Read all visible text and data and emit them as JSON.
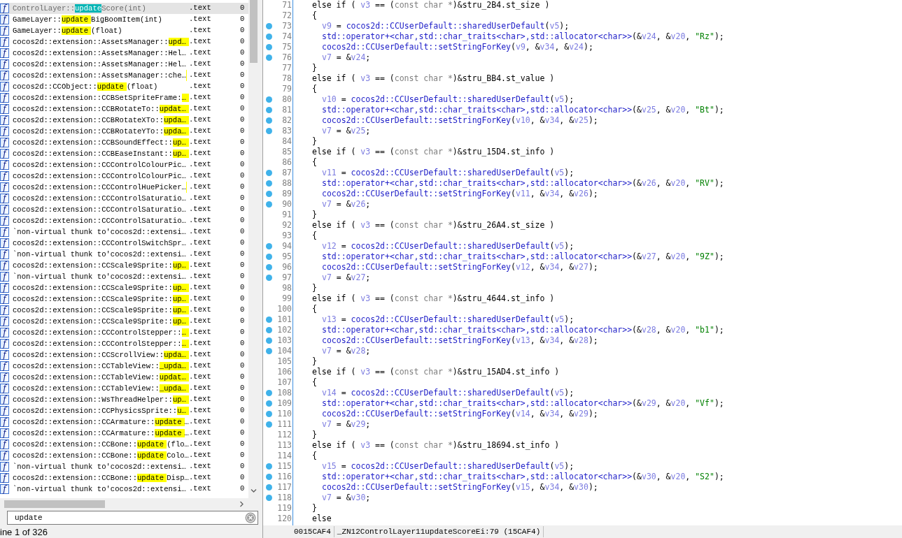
{
  "function_list": {
    "rows": [
      {
        "icon": "f",
        "before": "ControlLayer::",
        "match": "update",
        "after": "Score(int)",
        "segment": ".text",
        "column_3": "0",
        "selected": true
      },
      {
        "icon": "f",
        "before": "GameLayer::",
        "match": "update",
        "after": "BigBoomItem(int)",
        "segment": ".text",
        "column_3": "0",
        "selected": false
      },
      {
        "icon": "f",
        "before": "GameLayer::",
        "match": "update",
        "after": "(float)",
        "segment": ".text",
        "column_3": "0",
        "selected": false
      },
      {
        "icon": "f",
        "before": "cocos2d::extension::AssetsManager::",
        "match": "upd…",
        "segment": ".text",
        "column_3": "0",
        "selected": false
      },
      {
        "icon": "f",
        "before": "cocos2d::extension::AssetsManager::Hel…",
        "segment": ".text",
        "column_3": "0",
        "selected": false
      },
      {
        "icon": "f",
        "before": "cocos2d::extension::AssetsManager::Hel…",
        "segment": ".text",
        "column_3": "0",
        "selected": false
      },
      {
        "icon": "f",
        "before": "cocos2d::extension::AssetsManager::che…",
        "highlight_tail": true,
        "segment": ".text",
        "column_3": "0",
        "selected": false
      },
      {
        "icon": "f",
        "before": "cocos2d::CCObject::",
        "match": "update",
        "after": "(float)",
        "segment": ".text",
        "column_3": "0",
        "selected": false
      },
      {
        "icon": "f",
        "before": "cocos2d::extension::CCBSetSpriteFrame:",
        "match": "…",
        "segment": ".text",
        "column_3": "0",
        "selected": false
      },
      {
        "icon": "f",
        "before": "cocos2d::extension::CCBRotateTo::",
        "match": "updat…",
        "segment": ".text",
        "column_3": "0",
        "selected": false
      },
      {
        "icon": "f",
        "before": "cocos2d::extension::CCBRotateXTo::",
        "match": "upda…",
        "segment": ".text",
        "column_3": "0",
        "selected": false
      },
      {
        "icon": "f",
        "before": "cocos2d::extension::CCBRotateYTo::",
        "match": "upda…",
        "segment": ".text",
        "column_3": "0",
        "selected": false
      },
      {
        "icon": "f",
        "before": "cocos2d::extension::CCBSoundEffect::",
        "match": "up…",
        "segment": ".text",
        "column_3": "0",
        "selected": false
      },
      {
        "icon": "f",
        "before": "cocos2d::extension::CCBEaseInstant::",
        "match": "up…",
        "segment": ".text",
        "column_3": "0",
        "selected": false
      },
      {
        "icon": "f",
        "before": "cocos2d::extension::CCControlColourPic…",
        "segment": ".text",
        "column_3": "0",
        "selected": false
      },
      {
        "icon": "f",
        "before": "cocos2d::extension::CCControlColourPic…",
        "segment": ".text",
        "column_3": "0",
        "selected": false
      },
      {
        "icon": "f",
        "before": "cocos2d::extension::CCControlHuePicker…",
        "highlight_tail": true,
        "segment": ".text",
        "column_3": "0",
        "selected": false
      },
      {
        "icon": "f",
        "before": "cocos2d::extension::CCControlSaturatio…",
        "segment": ".text",
        "column_3": "0",
        "selected": false
      },
      {
        "icon": "f",
        "before": "cocos2d::extension::CCControlSaturatio…",
        "segment": ".text",
        "column_3": "0",
        "selected": false
      },
      {
        "icon": "f",
        "before": "cocos2d::extension::CCControlSaturatio…",
        "segment": ".text",
        "column_3": "0",
        "selected": false
      },
      {
        "icon": "f",
        "before": "`non-virtual thunk to'cocos2d::extensi…",
        "segment": ".text",
        "column_3": "0",
        "selected": false
      },
      {
        "icon": "f",
        "before": "cocos2d::extension::CCControlSwitchSpr…",
        "segment": ".text",
        "column_3": "0",
        "selected": false
      },
      {
        "icon": "f",
        "before": "`non-virtual thunk to'cocos2d::extensi…",
        "segment": ".text",
        "column_3": "0",
        "selected": false
      },
      {
        "icon": "f",
        "before": "cocos2d::extension::CCScale9Sprite::",
        "match": "up…",
        "segment": ".text",
        "column_3": "0",
        "selected": false
      },
      {
        "icon": "f",
        "before": "`non-virtual thunk to'cocos2d::extensi…",
        "segment": ".text",
        "column_3": "0",
        "selected": false
      },
      {
        "icon": "f",
        "before": "cocos2d::extension::CCScale9Sprite::",
        "match": "up…",
        "segment": ".text",
        "column_3": "0",
        "selected": false
      },
      {
        "icon": "f",
        "before": "cocos2d::extension::CCScale9Sprite::",
        "match": "up…",
        "segment": ".text",
        "column_3": "0",
        "selected": false
      },
      {
        "icon": "f",
        "before": "cocos2d::extension::CCScale9Sprite::",
        "match": "up…",
        "segment": ".text",
        "column_3": "0",
        "selected": false
      },
      {
        "icon": "f",
        "before": "cocos2d::extension::CCScale9Sprite::",
        "match": "up…",
        "segment": ".text",
        "column_3": "0",
        "selected": false
      },
      {
        "icon": "f",
        "before": "cocos2d::extension::CCControlStepper::",
        "match": "…",
        "segment": ".text",
        "column_3": "0",
        "selected": false
      },
      {
        "icon": "f",
        "before": "cocos2d::extension::CCControlStepper::",
        "match": "…",
        "segment": ".text",
        "column_3": "0",
        "selected": false
      },
      {
        "icon": "f",
        "before": "cocos2d::extension::CCScrollView::",
        "match": "upda…",
        "segment": ".text",
        "column_3": "0",
        "selected": false
      },
      {
        "icon": "f",
        "before": "cocos2d::extension::CCTableView::",
        "match": "_upda…",
        "segment": ".text",
        "column_3": "0",
        "selected": false
      },
      {
        "icon": "f",
        "before": "cocos2d::extension::CCTableView::",
        "match": "updat…",
        "segment": ".text",
        "column_3": "0",
        "selected": false
      },
      {
        "icon": "f",
        "before": "cocos2d::extension::CCTableView::",
        "match": "_upda…",
        "segment": ".text",
        "column_3": "0",
        "selected": false
      },
      {
        "icon": "f",
        "before": "cocos2d::extension::WsThreadHelper::",
        "match": "up…",
        "segment": ".text",
        "column_3": "0",
        "selected": false
      },
      {
        "icon": "f",
        "before": "cocos2d::extension::CCPhysicsSprite::",
        "match": "u…",
        "segment": ".text",
        "column_3": "0",
        "selected": false
      },
      {
        "icon": "f",
        "before": "cocos2d::extension::CCArmature::",
        "match": "update",
        "after": "…",
        "segment": ".text",
        "column_3": "0",
        "selected": false
      },
      {
        "icon": "f",
        "before": "cocos2d::extension::CCArmature::",
        "match": "update",
        "after": "…",
        "segment": ".text",
        "column_3": "0",
        "selected": false
      },
      {
        "icon": "f",
        "before": "cocos2d::extension::CCBone::",
        "match": "update",
        "after": "(flo…",
        "segment": ".text",
        "column_3": "0",
        "selected": false
      },
      {
        "icon": "f",
        "before": "cocos2d::extension::CCBone::",
        "match": "update",
        "after": "Colo…",
        "segment": ".text",
        "column_3": "0",
        "selected": false
      },
      {
        "icon": "f",
        "before": "`non-virtual thunk to'cocos2d::extensi…",
        "segment": ".text",
        "column_3": "0",
        "selected": false
      },
      {
        "icon": "f",
        "before": "cocos2d::extension::CCBone::",
        "match": "update",
        "after": "Disp…",
        "segment": ".text",
        "column_3": "0",
        "selected": false
      },
      {
        "icon": "f",
        "before": "`non-virtual thunk to'cocos2d::extensi…",
        "segment": ".text",
        "column_3": "0",
        "selected": false
      }
    ],
    "search": {
      "value": "update"
    },
    "status": "ine 1 of 326"
  },
  "code": {
    "lines": [
      {
        "number": "71",
        "dot": false,
        "tokens": [
          {
            "kind": "plain",
            "text": "else if ( "
          },
          {
            "kind": "var",
            "text": "v3"
          },
          {
            "kind": "plain",
            "text": " == ("
          },
          {
            "kind": "type",
            "text": "const char *"
          },
          {
            "kind": "plain",
            "text": ")&stru_2B4.st_size )"
          }
        ]
      },
      {
        "number": "72",
        "dot": false,
        "tokens": [
          {
            "kind": "plain",
            "text": "{"
          }
        ],
        "children": [
          {
            "number": "73",
            "dot": true,
            "tokens": [
              {
                "kind": "var",
                "text": "v9"
              },
              {
                "kind": "plain",
                "text": " = "
              },
              {
                "kind": "func",
                "text": "cocos2d::CCUserDefault::sharedUserDefault"
              },
              {
                "kind": "plain",
                "text": "("
              },
              {
                "kind": "var",
                "text": "v5"
              },
              {
                "kind": "plain",
                "text": ");"
              }
            ]
          },
          {
            "number": "74",
            "dot": true,
            "tokens": [
              {
                "kind": "func",
                "text": "std::operator+<char,std::char_traits<char>,std::allocator<char>>"
              },
              {
                "kind": "plain",
                "text": "(&"
              },
              {
                "kind": "var",
                "text": "v24"
              },
              {
                "kind": "plain",
                "text": ", &"
              },
              {
                "kind": "var",
                "text": "v20"
              },
              {
                "kind": "plain",
                "text": ", "
              },
              {
                "kind": "str",
                "text": "\"Rz\""
              },
              {
                "kind": "plain",
                "text": ");"
              }
            ]
          },
          {
            "number": "75",
            "dot": true,
            "tokens": [
              {
                "kind": "func",
                "text": "cocos2d::CCUserDefault::setStringForKey"
              },
              {
                "kind": "plain",
                "text": "("
              },
              {
                "kind": "var",
                "text": "v9"
              },
              {
                "kind": "plain",
                "text": ", &"
              },
              {
                "kind": "var",
                "text": "v34"
              },
              {
                "kind": "plain",
                "text": ", &"
              },
              {
                "kind": "var",
                "text": "v24"
              },
              {
                "kind": "plain",
                "text": ");"
              }
            ]
          },
          {
            "number": "76",
            "dot": true,
            "tokens": [
              {
                "kind": "var",
                "text": "v7"
              },
              {
                "kind": "plain",
                "text": " = &"
              },
              {
                "kind": "var",
                "text": "v24"
              },
              {
                "kind": "plain",
                "text": ";"
              }
            ]
          }
        ]
      },
      {
        "number": "77",
        "dot": false,
        "tokens": [
          {
            "kind": "plain",
            "text": "}"
          }
        ]
      },
      {
        "number": "78",
        "dot": false,
        "tokens": [
          {
            "kind": "plain",
            "text": "else if ( "
          },
          {
            "kind": "var",
            "text": "v3"
          },
          {
            "kind": "plain",
            "text": " == ("
          },
          {
            "kind": "type",
            "text": "const char *"
          },
          {
            "kind": "plain",
            "text": ")&stru_BB4.st_value )"
          }
        ]
      },
      {
        "number": "79",
        "dot": false,
        "tokens": [
          {
            "kind": "plain",
            "text": "{"
          }
        ],
        "children": [
          {
            "number": "80",
            "dot": true,
            "tokens": [
              {
                "kind": "var",
                "text": "v10"
              },
              {
                "kind": "plain",
                "text": " = "
              },
              {
                "kind": "func",
                "text": "cocos2d::CCUserDefault::sharedUserDefault"
              },
              {
                "kind": "plain",
                "text": "("
              },
              {
                "kind": "var",
                "text": "v5"
              },
              {
                "kind": "plain",
                "text": ");"
              }
            ]
          },
          {
            "number": "81",
            "dot": true,
            "tokens": [
              {
                "kind": "func",
                "text": "std::operator+<char,std::char_traits<char>,std::allocator<char>>"
              },
              {
                "kind": "plain",
                "text": "(&"
              },
              {
                "kind": "var",
                "text": "v25"
              },
              {
                "kind": "plain",
                "text": ", &"
              },
              {
                "kind": "var",
                "text": "v20"
              },
              {
                "kind": "plain",
                "text": ", "
              },
              {
                "kind": "str",
                "text": "\"Bt\""
              },
              {
                "kind": "plain",
                "text": ");"
              }
            ]
          },
          {
            "number": "82",
            "dot": true,
            "tokens": [
              {
                "kind": "func",
                "text": "cocos2d::CCUserDefault::setStringForKey"
              },
              {
                "kind": "plain",
                "text": "("
              },
              {
                "kind": "var",
                "text": "v10"
              },
              {
                "kind": "plain",
                "text": ", &"
              },
              {
                "kind": "var",
                "text": "v34"
              },
              {
                "kind": "plain",
                "text": ", &"
              },
              {
                "kind": "var",
                "text": "v25"
              },
              {
                "kind": "plain",
                "text": ");"
              }
            ]
          },
          {
            "number": "83",
            "dot": true,
            "tokens": [
              {
                "kind": "var",
                "text": "v7"
              },
              {
                "kind": "plain",
                "text": " = &"
              },
              {
                "kind": "var",
                "text": "v25"
              },
              {
                "kind": "plain",
                "text": ";"
              }
            ]
          }
        ]
      },
      {
        "number": "84",
        "dot": false,
        "tokens": [
          {
            "kind": "plain",
            "text": "}"
          }
        ]
      },
      {
        "number": "85",
        "dot": false,
        "tokens": [
          {
            "kind": "plain",
            "text": "else if ( "
          },
          {
            "kind": "var",
            "text": "v3"
          },
          {
            "kind": "plain",
            "text": " == ("
          },
          {
            "kind": "type",
            "text": "const char *"
          },
          {
            "kind": "plain",
            "text": ")&stru_15D4.st_info )"
          }
        ]
      },
      {
        "number": "86",
        "dot": false,
        "tokens": [
          {
            "kind": "plain",
            "text": "{"
          }
        ],
        "children": [
          {
            "number": "87",
            "dot": true,
            "tokens": [
              {
                "kind": "var",
                "text": "v11"
              },
              {
                "kind": "plain",
                "text": " = "
              },
              {
                "kind": "func",
                "text": "cocos2d::CCUserDefault::sharedUserDefault"
              },
              {
                "kind": "plain",
                "text": "("
              },
              {
                "kind": "var",
                "text": "v5"
              },
              {
                "kind": "plain",
                "text": ");"
              }
            ]
          },
          {
            "number": "88",
            "dot": true,
            "tokens": [
              {
                "kind": "func",
                "text": "std::operator+<char,std::char_traits<char>,std::allocator<char>>"
              },
              {
                "kind": "plain",
                "text": "(&"
              },
              {
                "kind": "var",
                "text": "v26"
              },
              {
                "kind": "plain",
                "text": ", &"
              },
              {
                "kind": "var",
                "text": "v20"
              },
              {
                "kind": "plain",
                "text": ", "
              },
              {
                "kind": "str",
                "text": "\"RV\""
              },
              {
                "kind": "plain",
                "text": ");"
              }
            ]
          },
          {
            "number": "89",
            "dot": true,
            "tokens": [
              {
                "kind": "func",
                "text": "cocos2d::CCUserDefault::setStringForKey"
              },
              {
                "kind": "plain",
                "text": "("
              },
              {
                "kind": "var",
                "text": "v11"
              },
              {
                "kind": "plain",
                "text": ", &"
              },
              {
                "kind": "var",
                "text": "v34"
              },
              {
                "kind": "plain",
                "text": ", &"
              },
              {
                "kind": "var",
                "text": "v26"
              },
              {
                "kind": "plain",
                "text": ");"
              }
            ]
          },
          {
            "number": "90",
            "dot": true,
            "tokens": [
              {
                "kind": "var",
                "text": "v7"
              },
              {
                "kind": "plain",
                "text": " = &"
              },
              {
                "kind": "var",
                "text": "v26"
              },
              {
                "kind": "plain",
                "text": ";"
              }
            ]
          }
        ]
      },
      {
        "number": "91",
        "dot": false,
        "tokens": [
          {
            "kind": "plain",
            "text": "}"
          }
        ]
      },
      {
        "number": "92",
        "dot": false,
        "tokens": [
          {
            "kind": "plain",
            "text": "else if ( "
          },
          {
            "kind": "var",
            "text": "v3"
          },
          {
            "kind": "plain",
            "text": " == ("
          },
          {
            "kind": "type",
            "text": "const char *"
          },
          {
            "kind": "plain",
            "text": ")&stru_26A4.st_size )"
          }
        ]
      },
      {
        "number": "93",
        "dot": false,
        "tokens": [
          {
            "kind": "plain",
            "text": "{"
          }
        ],
        "children": [
          {
            "number": "94",
            "dot": true,
            "tokens": [
              {
                "kind": "var",
                "text": "v12"
              },
              {
                "kind": "plain",
                "text": " = "
              },
              {
                "kind": "func",
                "text": "cocos2d::CCUserDefault::sharedUserDefault"
              },
              {
                "kind": "plain",
                "text": "("
              },
              {
                "kind": "var",
                "text": "v5"
              },
              {
                "kind": "plain",
                "text": ");"
              }
            ]
          },
          {
            "number": "95",
            "dot": true,
            "tokens": [
              {
                "kind": "func",
                "text": "std::operator+<char,std::char_traits<char>,std::allocator<char>>"
              },
              {
                "kind": "plain",
                "text": "(&"
              },
              {
                "kind": "var",
                "text": "v27"
              },
              {
                "kind": "plain",
                "text": ", &"
              },
              {
                "kind": "var",
                "text": "v20"
              },
              {
                "kind": "plain",
                "text": ", "
              },
              {
                "kind": "str",
                "text": "\"9Z\""
              },
              {
                "kind": "plain",
                "text": ");"
              }
            ]
          },
          {
            "number": "96",
            "dot": true,
            "tokens": [
              {
                "kind": "func",
                "text": "cocos2d::CCUserDefault::setStringForKey"
              },
              {
                "kind": "plain",
                "text": "("
              },
              {
                "kind": "var",
                "text": "v12"
              },
              {
                "kind": "plain",
                "text": ", &"
              },
              {
                "kind": "var",
                "text": "v34"
              },
              {
                "kind": "plain",
                "text": ", &"
              },
              {
                "kind": "var",
                "text": "v27"
              },
              {
                "kind": "plain",
                "text": ");"
              }
            ]
          },
          {
            "number": "97",
            "dot": true,
            "tokens": [
              {
                "kind": "var",
                "text": "v7"
              },
              {
                "kind": "plain",
                "text": " = &"
              },
              {
                "kind": "var",
                "text": "v27"
              },
              {
                "kind": "plain",
                "text": ";"
              }
            ]
          }
        ]
      },
      {
        "number": "98",
        "dot": false,
        "tokens": [
          {
            "kind": "plain",
            "text": "}"
          }
        ]
      },
      {
        "number": "99",
        "dot": false,
        "tokens": [
          {
            "kind": "plain",
            "text": "else if ( "
          },
          {
            "kind": "var",
            "text": "v3"
          },
          {
            "kind": "plain",
            "text": " == ("
          },
          {
            "kind": "type",
            "text": "const char *"
          },
          {
            "kind": "plain",
            "text": ")&stru_4644.st_info )"
          }
        ]
      },
      {
        "number": "100",
        "dot": false,
        "tokens": [
          {
            "kind": "plain",
            "text": "{"
          }
        ],
        "children": [
          {
            "number": "101",
            "dot": true,
            "tokens": [
              {
                "kind": "var",
                "text": "v13"
              },
              {
                "kind": "plain",
                "text": " = "
              },
              {
                "kind": "func",
                "text": "cocos2d::CCUserDefault::sharedUserDefault"
              },
              {
                "kind": "plain",
                "text": "("
              },
              {
                "kind": "var",
                "text": "v5"
              },
              {
                "kind": "plain",
                "text": ");"
              }
            ]
          },
          {
            "number": "102",
            "dot": true,
            "tokens": [
              {
                "kind": "func",
                "text": "std::operator+<char,std::char_traits<char>,std::allocator<char>>"
              },
              {
                "kind": "plain",
                "text": "(&"
              },
              {
                "kind": "var",
                "text": "v28"
              },
              {
                "kind": "plain",
                "text": ", &"
              },
              {
                "kind": "var",
                "text": "v20"
              },
              {
                "kind": "plain",
                "text": ", "
              },
              {
                "kind": "str",
                "text": "\"b1\""
              },
              {
                "kind": "plain",
                "text": ");"
              }
            ]
          },
          {
            "number": "103",
            "dot": true,
            "tokens": [
              {
                "kind": "func",
                "text": "cocos2d::CCUserDefault::setStringForKey"
              },
              {
                "kind": "plain",
                "text": "("
              },
              {
                "kind": "var",
                "text": "v13"
              },
              {
                "kind": "plain",
                "text": ", &"
              },
              {
                "kind": "var",
                "text": "v34"
              },
              {
                "kind": "plain",
                "text": ", &"
              },
              {
                "kind": "var",
                "text": "v28"
              },
              {
                "kind": "plain",
                "text": ");"
              }
            ]
          },
          {
            "number": "104",
            "dot": true,
            "tokens": [
              {
                "kind": "var",
                "text": "v7"
              },
              {
                "kind": "plain",
                "text": " = &"
              },
              {
                "kind": "var",
                "text": "v28"
              },
              {
                "kind": "plain",
                "text": ";"
              }
            ]
          }
        ]
      },
      {
        "number": "105",
        "dot": false,
        "tokens": [
          {
            "kind": "plain",
            "text": "}"
          }
        ]
      },
      {
        "number": "106",
        "dot": false,
        "tokens": [
          {
            "kind": "plain",
            "text": "else if ( "
          },
          {
            "kind": "var",
            "text": "v3"
          },
          {
            "kind": "plain",
            "text": " == ("
          },
          {
            "kind": "type",
            "text": "const char *"
          },
          {
            "kind": "plain",
            "text": ")&stru_15AD4.st_info )"
          }
        ]
      },
      {
        "number": "107",
        "dot": false,
        "tokens": [
          {
            "kind": "plain",
            "text": "{"
          }
        ],
        "children": [
          {
            "number": "108",
            "dot": true,
            "tokens": [
              {
                "kind": "var",
                "text": "v14"
              },
              {
                "kind": "plain",
                "text": " = "
              },
              {
                "kind": "func",
                "text": "cocos2d::CCUserDefault::sharedUserDefault"
              },
              {
                "kind": "plain",
                "text": "("
              },
              {
                "kind": "var",
                "text": "v5"
              },
              {
                "kind": "plain",
                "text": ");"
              }
            ]
          },
          {
            "number": "109",
            "dot": true,
            "tokens": [
              {
                "kind": "func",
                "text": "std::operator+<char,std::char_traits<char>,std::allocator<char>>"
              },
              {
                "kind": "plain",
                "text": "(&"
              },
              {
                "kind": "var",
                "text": "v29"
              },
              {
                "kind": "plain",
                "text": ", &"
              },
              {
                "kind": "var",
                "text": "v20"
              },
              {
                "kind": "plain",
                "text": ", "
              },
              {
                "kind": "str",
                "text": "\"Vf\""
              },
              {
                "kind": "plain",
                "text": ");"
              }
            ]
          },
          {
            "number": "110",
            "dot": true,
            "tokens": [
              {
                "kind": "func",
                "text": "cocos2d::CCUserDefault::setStringForKey"
              },
              {
                "kind": "plain",
                "text": "("
              },
              {
                "kind": "var",
                "text": "v14"
              },
              {
                "kind": "plain",
                "text": ", &"
              },
              {
                "kind": "var",
                "text": "v34"
              },
              {
                "kind": "plain",
                "text": ", &"
              },
              {
                "kind": "var",
                "text": "v29"
              },
              {
                "kind": "plain",
                "text": ");"
              }
            ]
          },
          {
            "number": "111",
            "dot": true,
            "tokens": [
              {
                "kind": "var",
                "text": "v7"
              },
              {
                "kind": "plain",
                "text": " = &"
              },
              {
                "kind": "var",
                "text": "v29"
              },
              {
                "kind": "plain",
                "text": ";"
              }
            ]
          }
        ]
      },
      {
        "number": "112",
        "dot": false,
        "tokens": [
          {
            "kind": "plain",
            "text": "}"
          }
        ]
      },
      {
        "number": "113",
        "dot": false,
        "tokens": [
          {
            "kind": "plain",
            "text": "else if ( "
          },
          {
            "kind": "var",
            "text": "v3"
          },
          {
            "kind": "plain",
            "text": " == ("
          },
          {
            "kind": "type",
            "text": "const char *"
          },
          {
            "kind": "plain",
            "text": ")&stru_18694.st_info )"
          }
        ]
      },
      {
        "number": "114",
        "dot": false,
        "tokens": [
          {
            "kind": "plain",
            "text": "{"
          }
        ],
        "children": [
          {
            "number": "115",
            "dot": true,
            "tokens": [
              {
                "kind": "var",
                "text": "v15"
              },
              {
                "kind": "plain",
                "text": " = "
              },
              {
                "kind": "func",
                "text": "cocos2d::CCUserDefault::sharedUserDefault"
              },
              {
                "kind": "plain",
                "text": "("
              },
              {
                "kind": "var",
                "text": "v5"
              },
              {
                "kind": "plain",
                "text": ");"
              }
            ]
          },
          {
            "number": "116",
            "dot": true,
            "tokens": [
              {
                "kind": "func",
                "text": "std::operator+<char,std::char_traits<char>,std::allocator<char>>"
              },
              {
                "kind": "plain",
                "text": "(&"
              },
              {
                "kind": "var",
                "text": "v30"
              },
              {
                "kind": "plain",
                "text": ", &"
              },
              {
                "kind": "var",
                "text": "v20"
              },
              {
                "kind": "plain",
                "text": ", "
              },
              {
                "kind": "str",
                "text": "\"S2\""
              },
              {
                "kind": "plain",
                "text": ");"
              }
            ]
          },
          {
            "number": "117",
            "dot": true,
            "tokens": [
              {
                "kind": "func",
                "text": "cocos2d::CCUserDefault::setStringForKey"
              },
              {
                "kind": "plain",
                "text": "("
              },
              {
                "kind": "var",
                "text": "v15"
              },
              {
                "kind": "plain",
                "text": ", &"
              },
              {
                "kind": "var",
                "text": "v34"
              },
              {
                "kind": "plain",
                "text": ", &"
              },
              {
                "kind": "var",
                "text": "v30"
              },
              {
                "kind": "plain",
                "text": ");"
              }
            ]
          },
          {
            "number": "118",
            "dot": true,
            "tokens": [
              {
                "kind": "var",
                "text": "v7"
              },
              {
                "kind": "plain",
                "text": " = &"
              },
              {
                "kind": "var",
                "text": "v30"
              },
              {
                "kind": "plain",
                "text": ";"
              }
            ]
          }
        ]
      },
      {
        "number": "119",
        "dot": false,
        "tokens": [
          {
            "kind": "plain",
            "text": "}"
          }
        ]
      },
      {
        "number": "120",
        "dot": false,
        "tokens": [
          {
            "kind": "plain",
            "text": "else"
          }
        ]
      }
    ],
    "status": {
      "address": "0015CAF4",
      "location": "_ZN12ControlLayer11updateScoreEi:79 (15CAF4)"
    }
  }
}
